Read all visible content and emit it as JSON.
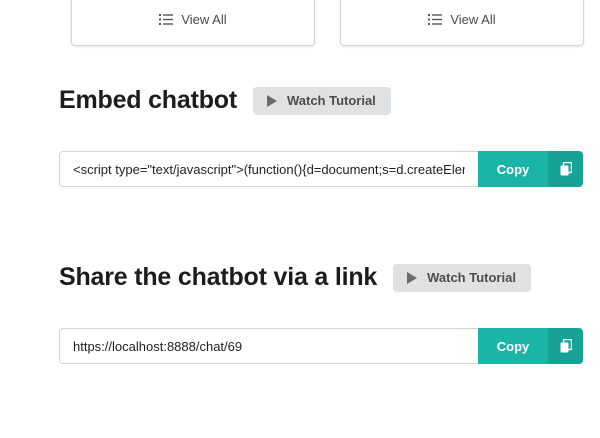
{
  "cards": [
    {
      "view_all_label": "View All"
    },
    {
      "view_all_label": "View All"
    }
  ],
  "embed": {
    "heading": "Embed chatbot",
    "tutorial_label": "Watch Tutorial",
    "code_value": "<script type=\"text/javascript\">(function(){d=document;s=d.createElement(\"script\");",
    "copy_label": "Copy"
  },
  "share": {
    "heading": "Share the chatbot via a link",
    "tutorial_label": "Watch Tutorial",
    "link_value": "https://localhost:8888/chat/69",
    "copy_label": "Copy"
  },
  "colors": {
    "copy_button": "#1bb5a7",
    "copy_icon_bg": "#16a396",
    "tutorial_button": "#e0e1e2"
  },
  "icons": {
    "view_all": "list-icon",
    "tutorial": "play-icon",
    "copy": "clipboard-icon"
  }
}
